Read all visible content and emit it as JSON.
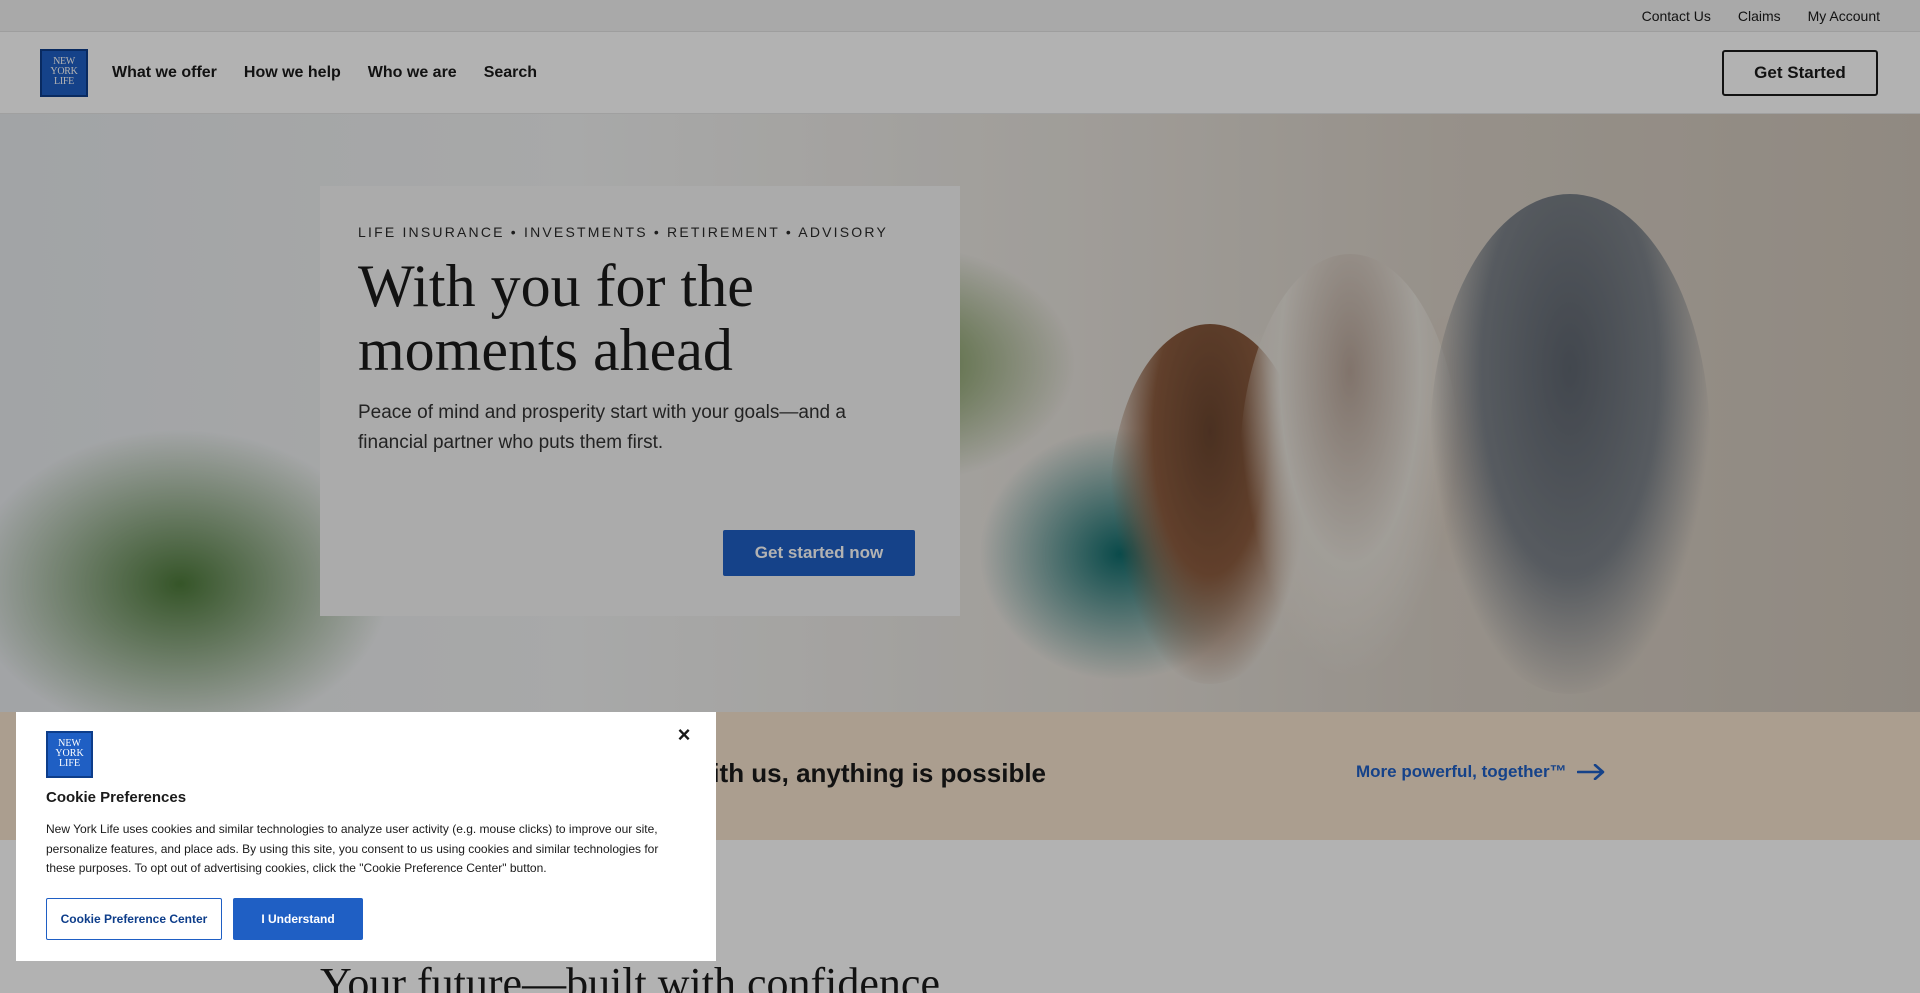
{
  "utility": {
    "links": [
      "Contact Us",
      "Claims",
      "My Account"
    ]
  },
  "brand": {
    "logo_lines": [
      "NEW",
      "YORK",
      "LIFE"
    ],
    "color": "#1f5fc4"
  },
  "nav": {
    "items": [
      "What we offer",
      "How we help",
      "Who we are",
      "Search"
    ],
    "cta_label": "Get Started"
  },
  "hero": {
    "eyebrow": "LIFE INSURANCE • INVESTMENTS • RETIREMENT • ADVISORY",
    "title": "With you for the moments ahead",
    "subtitle": "Peace of mind and prosperity start with your goals—and a financial partner who puts them first.",
    "button_label": "Get started now"
  },
  "band": {
    "text": "With us, anything is possible",
    "link_label": "More powerful, together™",
    "background": "#f5e2cd"
  },
  "section": {
    "title": "Your future—built with confidence"
  },
  "cookie": {
    "title": "Cookie Preferences",
    "body": "New York Life uses cookies and similar technologies to analyze user activity (e.g. mouse clicks) to improve our site, personalize features, and place ads. By using this site, you consent to us using cookies and similar technologies for these purposes. To opt out of advertising cookies, click the \"Cookie Preference Center\" button.",
    "pref_button": "Cookie Preference Center",
    "accept_button": "I Understand",
    "close_icon": "close-icon"
  }
}
